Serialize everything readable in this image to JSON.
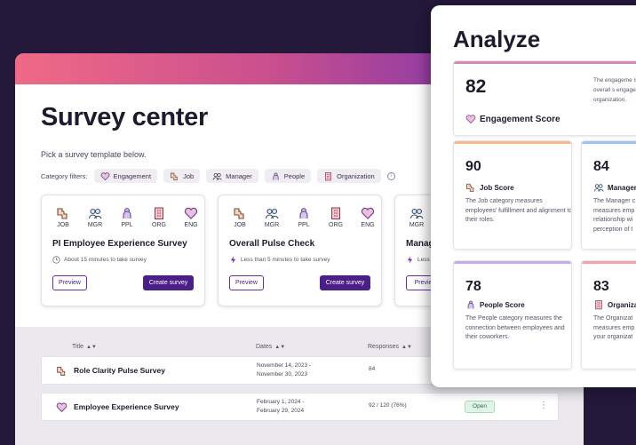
{
  "survey_center": {
    "title": "Survey center",
    "subtitle": "Pick a survey template below.",
    "filters_label": "Category filters:",
    "filters": [
      {
        "label": "Engagement",
        "icon": "heart-icon"
      },
      {
        "label": "Job",
        "icon": "puzzle-icon"
      },
      {
        "label": "Manager",
        "icon": "manager-icon"
      },
      {
        "label": "People",
        "icon": "people-icon"
      },
      {
        "label": "Organization",
        "icon": "building-icon"
      }
    ],
    "templates": [
      {
        "icons": [
          "JOB",
          "MGR",
          "PPL",
          "ORG",
          "ENG"
        ],
        "name": "PI Employee Experience Survey",
        "time": "About 15 minutes to take survey",
        "time_icon": "clock-icon",
        "preview": "Preview",
        "create": "Create survey"
      },
      {
        "icons": [
          "JOB",
          "MGR",
          "PPL",
          "ORG",
          "ENG"
        ],
        "name": "Overall Pulse Check",
        "time": "Less than 5 minutes to take survey",
        "time_icon": "bolt-icon",
        "preview": "Preview",
        "create": "Create survey"
      },
      {
        "icons": [
          "MGR"
        ],
        "name": "Manag",
        "time": "Less",
        "time_icon": "bolt-icon",
        "preview": "Previe",
        "create": ""
      }
    ],
    "table": {
      "headers": {
        "title": "Title",
        "dates": "Dates",
        "responses": "Responses"
      },
      "rows": [
        {
          "name": "Role Clarity Pulse Survey",
          "icon": "puzzle-icon",
          "date_start": "November 14, 2023 -",
          "date_end": "November 30, 2023",
          "responses": "84",
          "status": ""
        },
        {
          "name": "Employee Experience Survey",
          "icon": "heart-icon",
          "date_start": "February 1, 2024 -",
          "date_end": "February 29, 2024",
          "responses": "92 / 120 (76%)",
          "status": "Open"
        }
      ]
    }
  },
  "analyze": {
    "title": "Analyze",
    "engagement": {
      "score": "82",
      "label": "Engagement Score",
      "desc": "The engageme is an overall s engagement a organization."
    },
    "cards": [
      {
        "score": "90",
        "label": "Job Score",
        "icon": "puzzle-icon",
        "desc": "The Job category measures employees' fulfillment and alignment to their roles.",
        "accent": "#f6b98f"
      },
      {
        "score": "84",
        "label": "Manager",
        "icon": "manager-icon",
        "desc": "The Manager c measures emp relationship wi perception of t",
        "accent": "#9ac4f2"
      },
      {
        "score": "78",
        "label": "People Score",
        "icon": "people-icon",
        "desc": "The People category measures the connection between employees and their coworkers.",
        "accent": "#c8a8ea"
      },
      {
        "score": "83",
        "label": "Organiza",
        "icon": "building-icon",
        "desc": "The Organizat measures emp your organizat",
        "accent": "#f2a2b0"
      }
    ],
    "engagement_accent": "#d58ab3"
  },
  "colors": {
    "background": "#24183b",
    "primary": "#4a1f86",
    "icon_purple": "#7b4aa8",
    "heart": "#b0499e",
    "open_badge": "#dff5e8"
  }
}
